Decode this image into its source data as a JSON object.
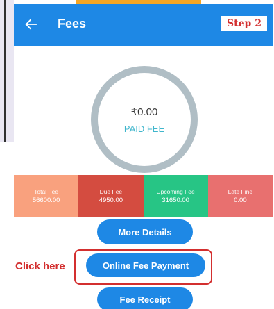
{
  "appbar": {
    "title": "Fees",
    "step": "Step 2"
  },
  "paid": {
    "amount": "₹0.00",
    "label": "PAID FEE"
  },
  "tiles": [
    {
      "label": "Total Fee",
      "value": "56600.00",
      "color": "#f9a17e"
    },
    {
      "label": "Due Fee",
      "value": "4950.00",
      "color": "#d44c40"
    },
    {
      "label": "Upcoming Fee",
      "value": "31650.00",
      "color": "#27c585"
    },
    {
      "label": "Late Fine",
      "value": "0.00",
      "color": "#e8706f"
    }
  ],
  "buttons": {
    "more_details": "More Details",
    "online_payment": "Online Fee Payment",
    "fee_receipt": "Fee Receipt"
  },
  "annotation": {
    "click_here": "Click here"
  },
  "colors": {
    "primary": "#1e88e5",
    "accent": "#d32f2f",
    "ring": "#b0bec5",
    "paid_label": "#3fb6cc"
  },
  "icons": {
    "back": "arrow-left-icon"
  }
}
